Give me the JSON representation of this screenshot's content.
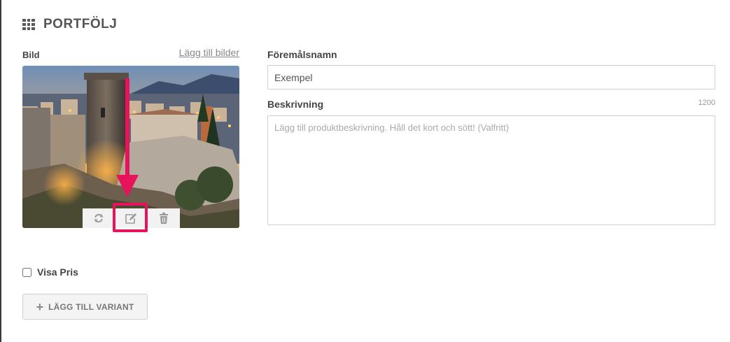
{
  "header": {
    "title": "PORTFÖLJ",
    "icon": "grid-icon"
  },
  "image_section": {
    "label": "Bild",
    "add_link": "Lägg till bilder",
    "photo_subject": "castle-town-at-dusk",
    "toolbar": {
      "replace_icon": "refresh-icon",
      "edit_icon": "edit-icon",
      "delete_icon": "trash-icon"
    },
    "highlight_color": "#e8135a"
  },
  "form": {
    "name_label": "Föremålsnamn",
    "name_value": "Exempel",
    "desc_label": "Beskrivning",
    "desc_counter": "1200",
    "desc_placeholder": "Lägg till produktbeskrivning. Håll det kort och sött! (Valfritt)"
  },
  "price": {
    "label": "Visa Pris",
    "checked": false
  },
  "variant_button": {
    "label": "LÄGG TILL VARIANT",
    "icon": "plus-icon"
  }
}
